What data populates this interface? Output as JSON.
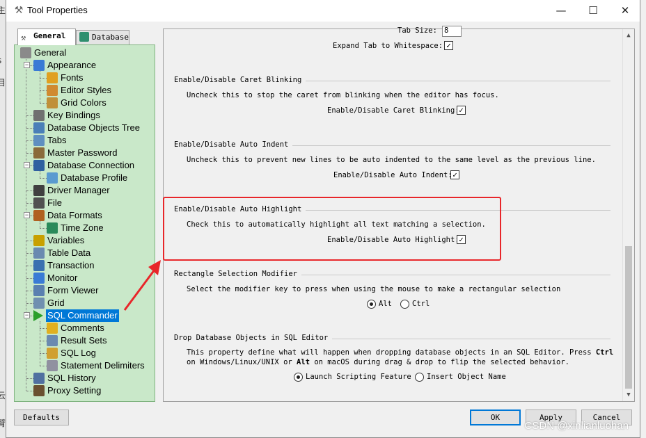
{
  "window": {
    "title": "Tool Properties"
  },
  "titlebar": {
    "minimize": "—",
    "maximize": "☐",
    "close": "✕"
  },
  "tabs": [
    {
      "label": "General",
      "active": true
    },
    {
      "label": "Database",
      "active": false
    }
  ],
  "tree": {
    "items": [
      {
        "label": "General",
        "icon": "tools-icon",
        "level": 0
      },
      {
        "label": "Appearance",
        "icon": "monitor-icon",
        "level": 1,
        "expander": "−"
      },
      {
        "label": "Fonts",
        "icon": "font-icon",
        "level": 2
      },
      {
        "label": "Editor Styles",
        "icon": "styles-icon",
        "level": 2
      },
      {
        "label": "Grid Colors",
        "icon": "palette-icon",
        "level": 2
      },
      {
        "label": "Key Bindings",
        "icon": "keyboard-icon",
        "level": 1
      },
      {
        "label": "Database Objects Tree",
        "icon": "tree-icon",
        "level": 1
      },
      {
        "label": "Tabs",
        "icon": "tabs-icon",
        "level": 1
      },
      {
        "label": "Master Password",
        "icon": "key-icon",
        "level": 1
      },
      {
        "label": "Database Connection",
        "icon": "database-icon",
        "level": 1,
        "expander": "−"
      },
      {
        "label": "Database Profile",
        "icon": "profile-icon",
        "level": 2
      },
      {
        "label": "Driver Manager",
        "icon": "driver-icon",
        "level": 1
      },
      {
        "label": "File",
        "icon": "file-icon",
        "level": 1
      },
      {
        "label": "Data Formats",
        "icon": "percent-icon",
        "level": 1,
        "expander": "−"
      },
      {
        "label": "Time Zone",
        "icon": "globe-icon",
        "level": 2
      },
      {
        "label": "Variables",
        "icon": "dollar-icon",
        "level": 1
      },
      {
        "label": "Table Data",
        "icon": "table-icon",
        "level": 1
      },
      {
        "label": "Transaction",
        "icon": "transaction-icon",
        "level": 1
      },
      {
        "label": "Monitor",
        "icon": "monitor-icon",
        "level": 1
      },
      {
        "label": "Form Viewer",
        "icon": "form-icon",
        "level": 1
      },
      {
        "label": "Grid",
        "icon": "grid-icon",
        "level": 1
      },
      {
        "label": "SQL Commander",
        "icon": "play-icon",
        "level": 1,
        "expander": "−",
        "selected": true
      },
      {
        "label": "Comments",
        "icon": "comment-icon",
        "level": 2
      },
      {
        "label": "Result Sets",
        "icon": "table-icon",
        "level": 2
      },
      {
        "label": "SQL Log",
        "icon": "log-icon",
        "level": 2
      },
      {
        "label": "Statement Delimiters",
        "icon": "delimiter-icon",
        "level": 2
      },
      {
        "label": "SQL History",
        "icon": "history-icon",
        "level": 1
      },
      {
        "label": "Proxy Setting",
        "icon": "proxy-icon",
        "level": 1
      }
    ]
  },
  "content": {
    "top": {
      "tab_size_label": "Tab Size:",
      "tab_size_value": "8",
      "expand_tab_label": "Expand Tab to Whitespace:",
      "expand_tab_checked": true
    },
    "caret": {
      "heading": "Enable/Disable Caret Blinking",
      "description": "Uncheck this to stop the caret from blinking when the editor has focus.",
      "option_label": "Enable/Disable Caret Blinking:",
      "checked": true
    },
    "indent": {
      "heading": "Enable/Disable Auto Indent",
      "description": "Uncheck this to prevent new lines to be auto indented to the same level as the previous line.",
      "option_label": "Enable/Disable Auto Indent:",
      "checked": true
    },
    "highlight": {
      "heading": "Enable/Disable Auto Highlight",
      "description": "Check this to automatically highlight all text matching a selection.",
      "option_label": "Enable/Disable Auto Highlight:",
      "checked": true
    },
    "rectangle": {
      "heading": "Rectangle Selection Modifier",
      "description": "Select the modifier key to press when using the mouse to make a rectangular selection",
      "option_alt": "Alt",
      "option_ctrl": "Ctrl",
      "selected": "Alt"
    },
    "drop": {
      "heading": "Drop Database Objects in SQL Editor",
      "desc_line1_pre": "This property define what will happen when dropping database objects in an SQL Editor. Press ",
      "desc_ctrl": "Ctrl",
      "desc_line2_pre": "on Windows/Linux/UNIX or ",
      "desc_alt": "Alt",
      "desc_line2_post": " on macOS during drag & drop to flip the selected behavior.",
      "option_launch": "Launch Scripting Feature",
      "option_insert": "Insert Object Name",
      "selected": "Launch Scripting Feature"
    }
  },
  "buttons": {
    "defaults": "Defaults",
    "ok": "OK",
    "apply": "Apply",
    "cancel": "Cancel"
  },
  "watermark": "CSDN @xinlianluohan",
  "colors": {
    "tree_bg": "#c9e8c9",
    "selection": "#0078d7",
    "annotation_red": "#e8262a"
  }
}
